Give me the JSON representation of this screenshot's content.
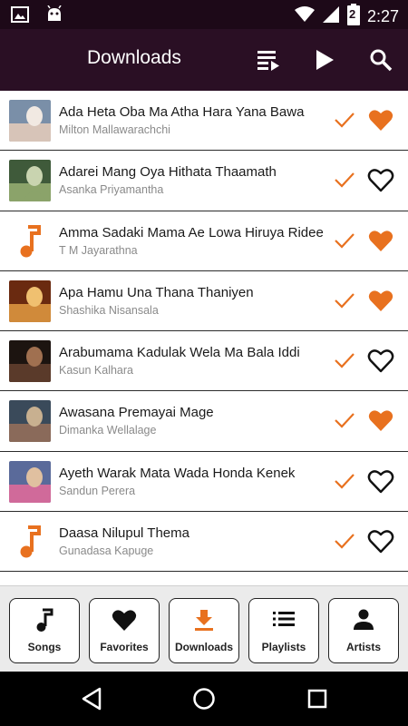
{
  "status_bar": {
    "time": "2:27",
    "battery_level": "2",
    "icons": [
      "image-icon",
      "android-icon",
      "wifi-icon",
      "signal-icon",
      "battery-icon"
    ]
  },
  "app_bar": {
    "title": "Downloads",
    "actions": [
      "queue-icon",
      "play-icon",
      "search-icon"
    ]
  },
  "songs": [
    {
      "title": "Ada Heta Oba Ma Atha Hara Yana Bawa",
      "artist": "Milton Mallawarachchi",
      "favorite": true,
      "thumb": "photo"
    },
    {
      "title": "Adarei Mang Oya Hithata Thaamath",
      "artist": "Asanka Priyamantha",
      "favorite": false,
      "thumb": "photo"
    },
    {
      "title": "Amma Sadaki Mama Ae Lowa Hiruya Ridee",
      "artist": "T M Jayarathna",
      "favorite": true,
      "thumb": "note"
    },
    {
      "title": "Apa Hamu Una Thana Thaniyen",
      "artist": "Shashika Nisansala",
      "favorite": true,
      "thumb": "photo"
    },
    {
      "title": "Arabumama Kadulak Wela Ma Bala Iddi",
      "artist": "Kasun Kalhara",
      "favorite": false,
      "thumb": "photo"
    },
    {
      "title": "Awasana Premayai Mage",
      "artist": "Dimanka Wellalage",
      "favorite": true,
      "thumb": "photo"
    },
    {
      "title": "Ayeth Warak Mata Wada Honda Kenek",
      "artist": "Sandun Perera",
      "favorite": false,
      "thumb": "photo"
    },
    {
      "title": "Daasa Nilupul Thema",
      "artist": "Gunadasa Kapuge",
      "favorite": false,
      "thumb": "note"
    }
  ],
  "bottom_nav": {
    "songs": "Songs",
    "favorites": "Favorites",
    "downloads": "Downloads",
    "playlists": "Playlists",
    "artists": "Artists",
    "active": "downloads"
  },
  "colors": {
    "accent": "#e8711f",
    "app_bar": "#2a0f24",
    "status_bar": "#1d0918"
  }
}
